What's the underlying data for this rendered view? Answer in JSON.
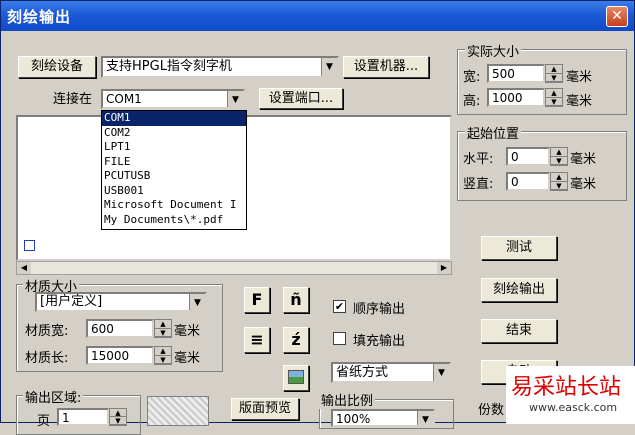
{
  "window": {
    "title": "刻绘输出",
    "close": "✕"
  },
  "device": {
    "button": "刻绘设备",
    "driver_value": "支持HPGL指令刻字机",
    "setup_button": "设置机器...",
    "port_label": "连接在",
    "port_value": "COM1",
    "port_setup_button": "设置端口...",
    "port_options": [
      "COM1",
      "COM2",
      "LPT1",
      "FILE",
      "PCUTUSB",
      "USB001",
      "Microsoft Document I",
      "My Documents\\*.pdf"
    ]
  },
  "actual_size": {
    "title": "实际大小",
    "width_label": "宽:",
    "width_value": "500",
    "height_label": "高:",
    "height_value": "1000",
    "unit": "毫米"
  },
  "start_pos": {
    "title": "起始位置",
    "h_label": "水平:",
    "h_value": "0",
    "v_label": "竖直:",
    "v_value": "0",
    "unit": "毫米"
  },
  "material": {
    "title": "材质大小",
    "preset": "[用户定义]",
    "width_label": "材质宽:",
    "width_value": "600",
    "length_label": "材质长:",
    "length_value": "15000",
    "unit": "毫米"
  },
  "tools": {
    "f": "F",
    "a": "ñ",
    "lines": "≡",
    "z": "ź"
  },
  "options": {
    "sequential": "顺序输出",
    "sequential_checked": "✔",
    "fill": "填充输出",
    "paper_mode": "省纸方式"
  },
  "actions": {
    "test": "测试",
    "cut": "刻绘输出",
    "end": "结束",
    "auto": "自动"
  },
  "output_area": {
    "title": "输出区域:",
    "page_label": "页",
    "page_value": "1",
    "preview_button": "版面预览"
  },
  "scale": {
    "title": "输出比例",
    "value": "100%"
  },
  "copies_label": "份数",
  "watermark": {
    "title": "易采站长站",
    "url": "www.easck.com"
  }
}
